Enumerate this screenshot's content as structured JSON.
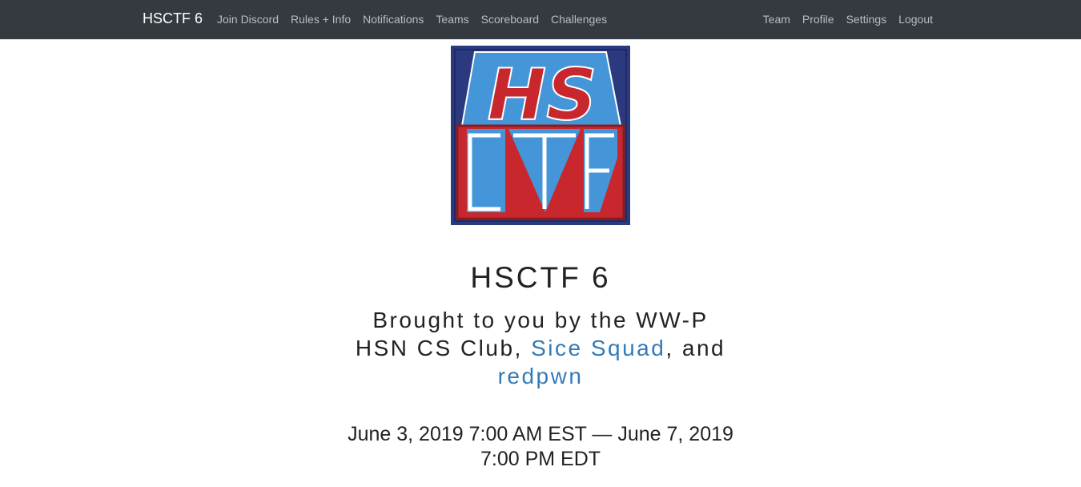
{
  "navbar": {
    "brand": "HSCTF 6",
    "left_items": [
      {
        "label": "Join Discord"
      },
      {
        "label": "Rules + Info"
      },
      {
        "label": "Notifications"
      },
      {
        "label": "Teams"
      },
      {
        "label": "Scoreboard"
      },
      {
        "label": "Challenges"
      }
    ],
    "right_items": [
      {
        "label": "Team"
      },
      {
        "label": "Profile"
      },
      {
        "label": "Settings"
      },
      {
        "label": "Logout"
      }
    ]
  },
  "logo": {
    "text_top": "HS",
    "text_bottom": "CTF",
    "colors": {
      "navy": "#2b3a7e",
      "blue": "#4496d9",
      "red": "#c8282d",
      "white": "#ffffff"
    }
  },
  "hero": {
    "title": "HSCTF 6",
    "subtitle_prefix": "Brought to you by the WW-P HSN CS Club, ",
    "link1": "Sice Squad",
    "subtitle_mid": ", and",
    "link2": "redpwn",
    "dates": "June 3, 2019 7:00 AM EST — June 7, 2019 7:00 PM EDT"
  },
  "colors": {
    "navbar_bg": "#343a40",
    "link": "#337ab7",
    "nav_text": "#b9bdc1"
  }
}
